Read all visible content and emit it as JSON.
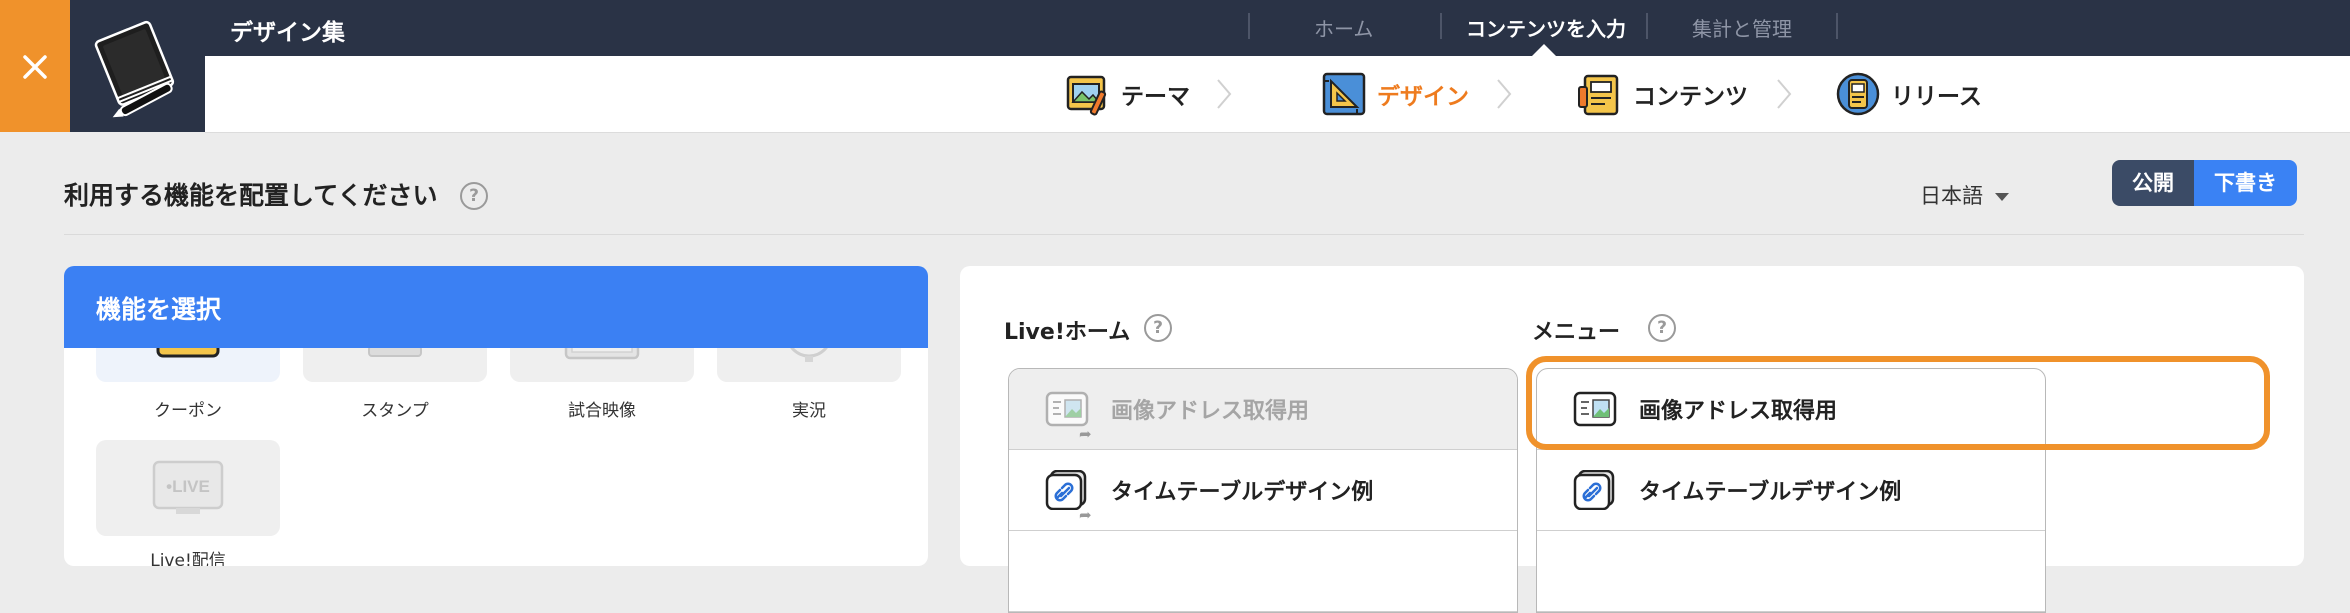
{
  "app": {
    "title": "デザイン集",
    "close_label": "×"
  },
  "topnav": {
    "home": "ホーム",
    "content_input": "コンテンツを入力",
    "stats": "集計と管理"
  },
  "steps": [
    {
      "label": "テーマ",
      "icon": "theme-icon"
    },
    {
      "label": "デザイン",
      "icon": "design-icon",
      "active": true
    },
    {
      "label": "コンテンツ",
      "icon": "content-icon"
    },
    {
      "label": "リリース",
      "icon": "release-icon"
    }
  ],
  "page": {
    "title": "利用する機能を配置してください",
    "help": "?",
    "language": "日本語"
  },
  "publish": {
    "public_label": "公開",
    "draft_label": "下書き"
  },
  "left_panel": {
    "title": "機能を選択",
    "features": [
      {
        "label": "クーポン",
        "icon": "coupon-icon"
      },
      {
        "label": "スタンプ",
        "icon": "stamp-icon"
      },
      {
        "label": "試合映像",
        "icon": "tv-icon"
      },
      {
        "label": "実況",
        "icon": "microphone-icon"
      },
      {
        "label": "Live!配信",
        "icon": "live-icon",
        "badge": "•LIVE"
      }
    ]
  },
  "right_panel": {
    "live_home": {
      "title": "Live!ホーム",
      "help": "?",
      "items": [
        {
          "label": "画像アドレス取得用",
          "icon": "image-address-icon",
          "disabled": true
        },
        {
          "label": "タイムテーブルデザイン例",
          "icon": "link-icon"
        }
      ]
    },
    "menu": {
      "title": "メニュー",
      "help": "?",
      "items": [
        {
          "label": "画像アドレス取得用",
          "icon": "image-address-icon"
        },
        {
          "label": "タイムテーブルデザイン例",
          "icon": "link-icon"
        }
      ]
    }
  },
  "colors": {
    "accent_orange": "#f0922b",
    "primary_blue": "#3b80f3",
    "topbar": "#2a3346"
  }
}
